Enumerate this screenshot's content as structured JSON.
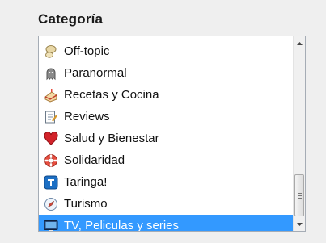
{
  "heading": "Categoría",
  "category_list": {
    "items": [
      {
        "label": "Off-topic",
        "icon": "comment-icon"
      },
      {
        "label": "Paranormal",
        "icon": "ghost-icon"
      },
      {
        "label": "Recetas y Cocina",
        "icon": "cake-icon"
      },
      {
        "label": "Reviews",
        "icon": "review-icon"
      },
      {
        "label": "Salud y Bienestar",
        "icon": "heart-icon"
      },
      {
        "label": "Solidaridad",
        "icon": "lifebuoy-icon"
      },
      {
        "label": "Taringa!",
        "icon": "taringa-icon"
      },
      {
        "label": "Turismo",
        "icon": "compass-icon"
      },
      {
        "label": "TV, Peliculas y series",
        "icon": "monitor-icon"
      }
    ],
    "selected": "TV, Peliculas y series"
  },
  "colors": {
    "selection": "#3399ff",
    "background": "#efefef",
    "list_border": "#a5acb5"
  }
}
